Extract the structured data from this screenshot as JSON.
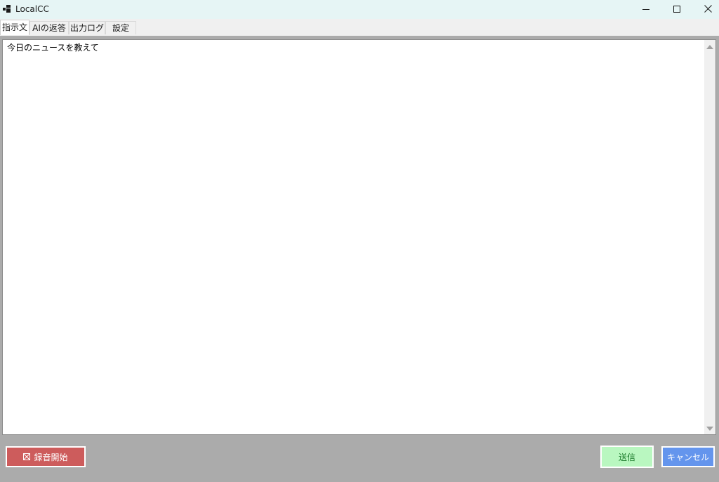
{
  "window": {
    "title": "LocalCC",
    "icon": "app-window-icon",
    "controls": {
      "minimize_icon": "minimize-icon",
      "maximize_icon": "maximize-icon",
      "close_icon": "close-icon"
    }
  },
  "tabs": [
    {
      "label": "指示文",
      "active": true
    },
    {
      "label": "AIの返答",
      "active": false
    },
    {
      "label": "出力ログ",
      "active": false
    },
    {
      "label": "設定",
      "active": false
    }
  ],
  "prompt": {
    "value": "今日のニュースを教えて"
  },
  "buttons": {
    "record_label": "録音開始",
    "record_icon": "checkbox-crossed-icon",
    "send_label": "送信",
    "cancel_label": "キャンセル"
  },
  "colors": {
    "titlebar": "#e6f5f5",
    "panel_background": "#ababab",
    "record_button": "#cd5c5c",
    "send_button": "#b9f7c0",
    "cancel_button": "#6495ed"
  }
}
